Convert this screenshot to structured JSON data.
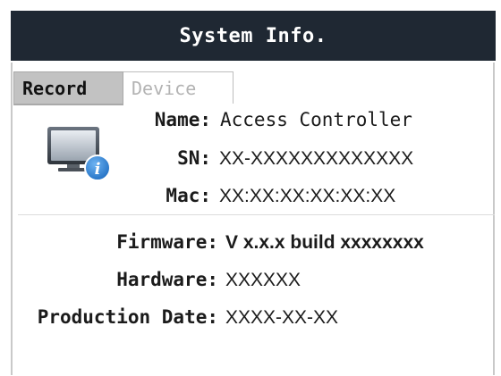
{
  "window": {
    "title": "System Info."
  },
  "tabs": [
    {
      "label": "Record",
      "state": "active"
    },
    {
      "label": "Device",
      "state": "inactive"
    }
  ],
  "device_icon": "monitor-info-icon",
  "device_info": {
    "name_label": "Name:",
    "name_value": "Access Controller",
    "sn_label": "SN:",
    "sn_value": "XX-XXXXXXXXXXXXX",
    "mac_label": "Mac:",
    "mac_value": "XX:XX:XX:XX:XX:XX"
  },
  "version_info": {
    "firmware_label": "Firmware:",
    "firmware_value": "V x.x.x build xxxxxxxx",
    "hardware_label": "Hardware:",
    "hardware_value": "XXXXXX",
    "production_date_label": "Production Date:",
    "production_date_value": "XXXX-XX-XX"
  },
  "colors": {
    "title_bar_bg": "#1f2833",
    "title_text": "#ffffff",
    "active_tab_bg": "#c2c2c2",
    "inactive_tab_text": "#b3b3b3",
    "info_badge": "#2f7fd0"
  }
}
